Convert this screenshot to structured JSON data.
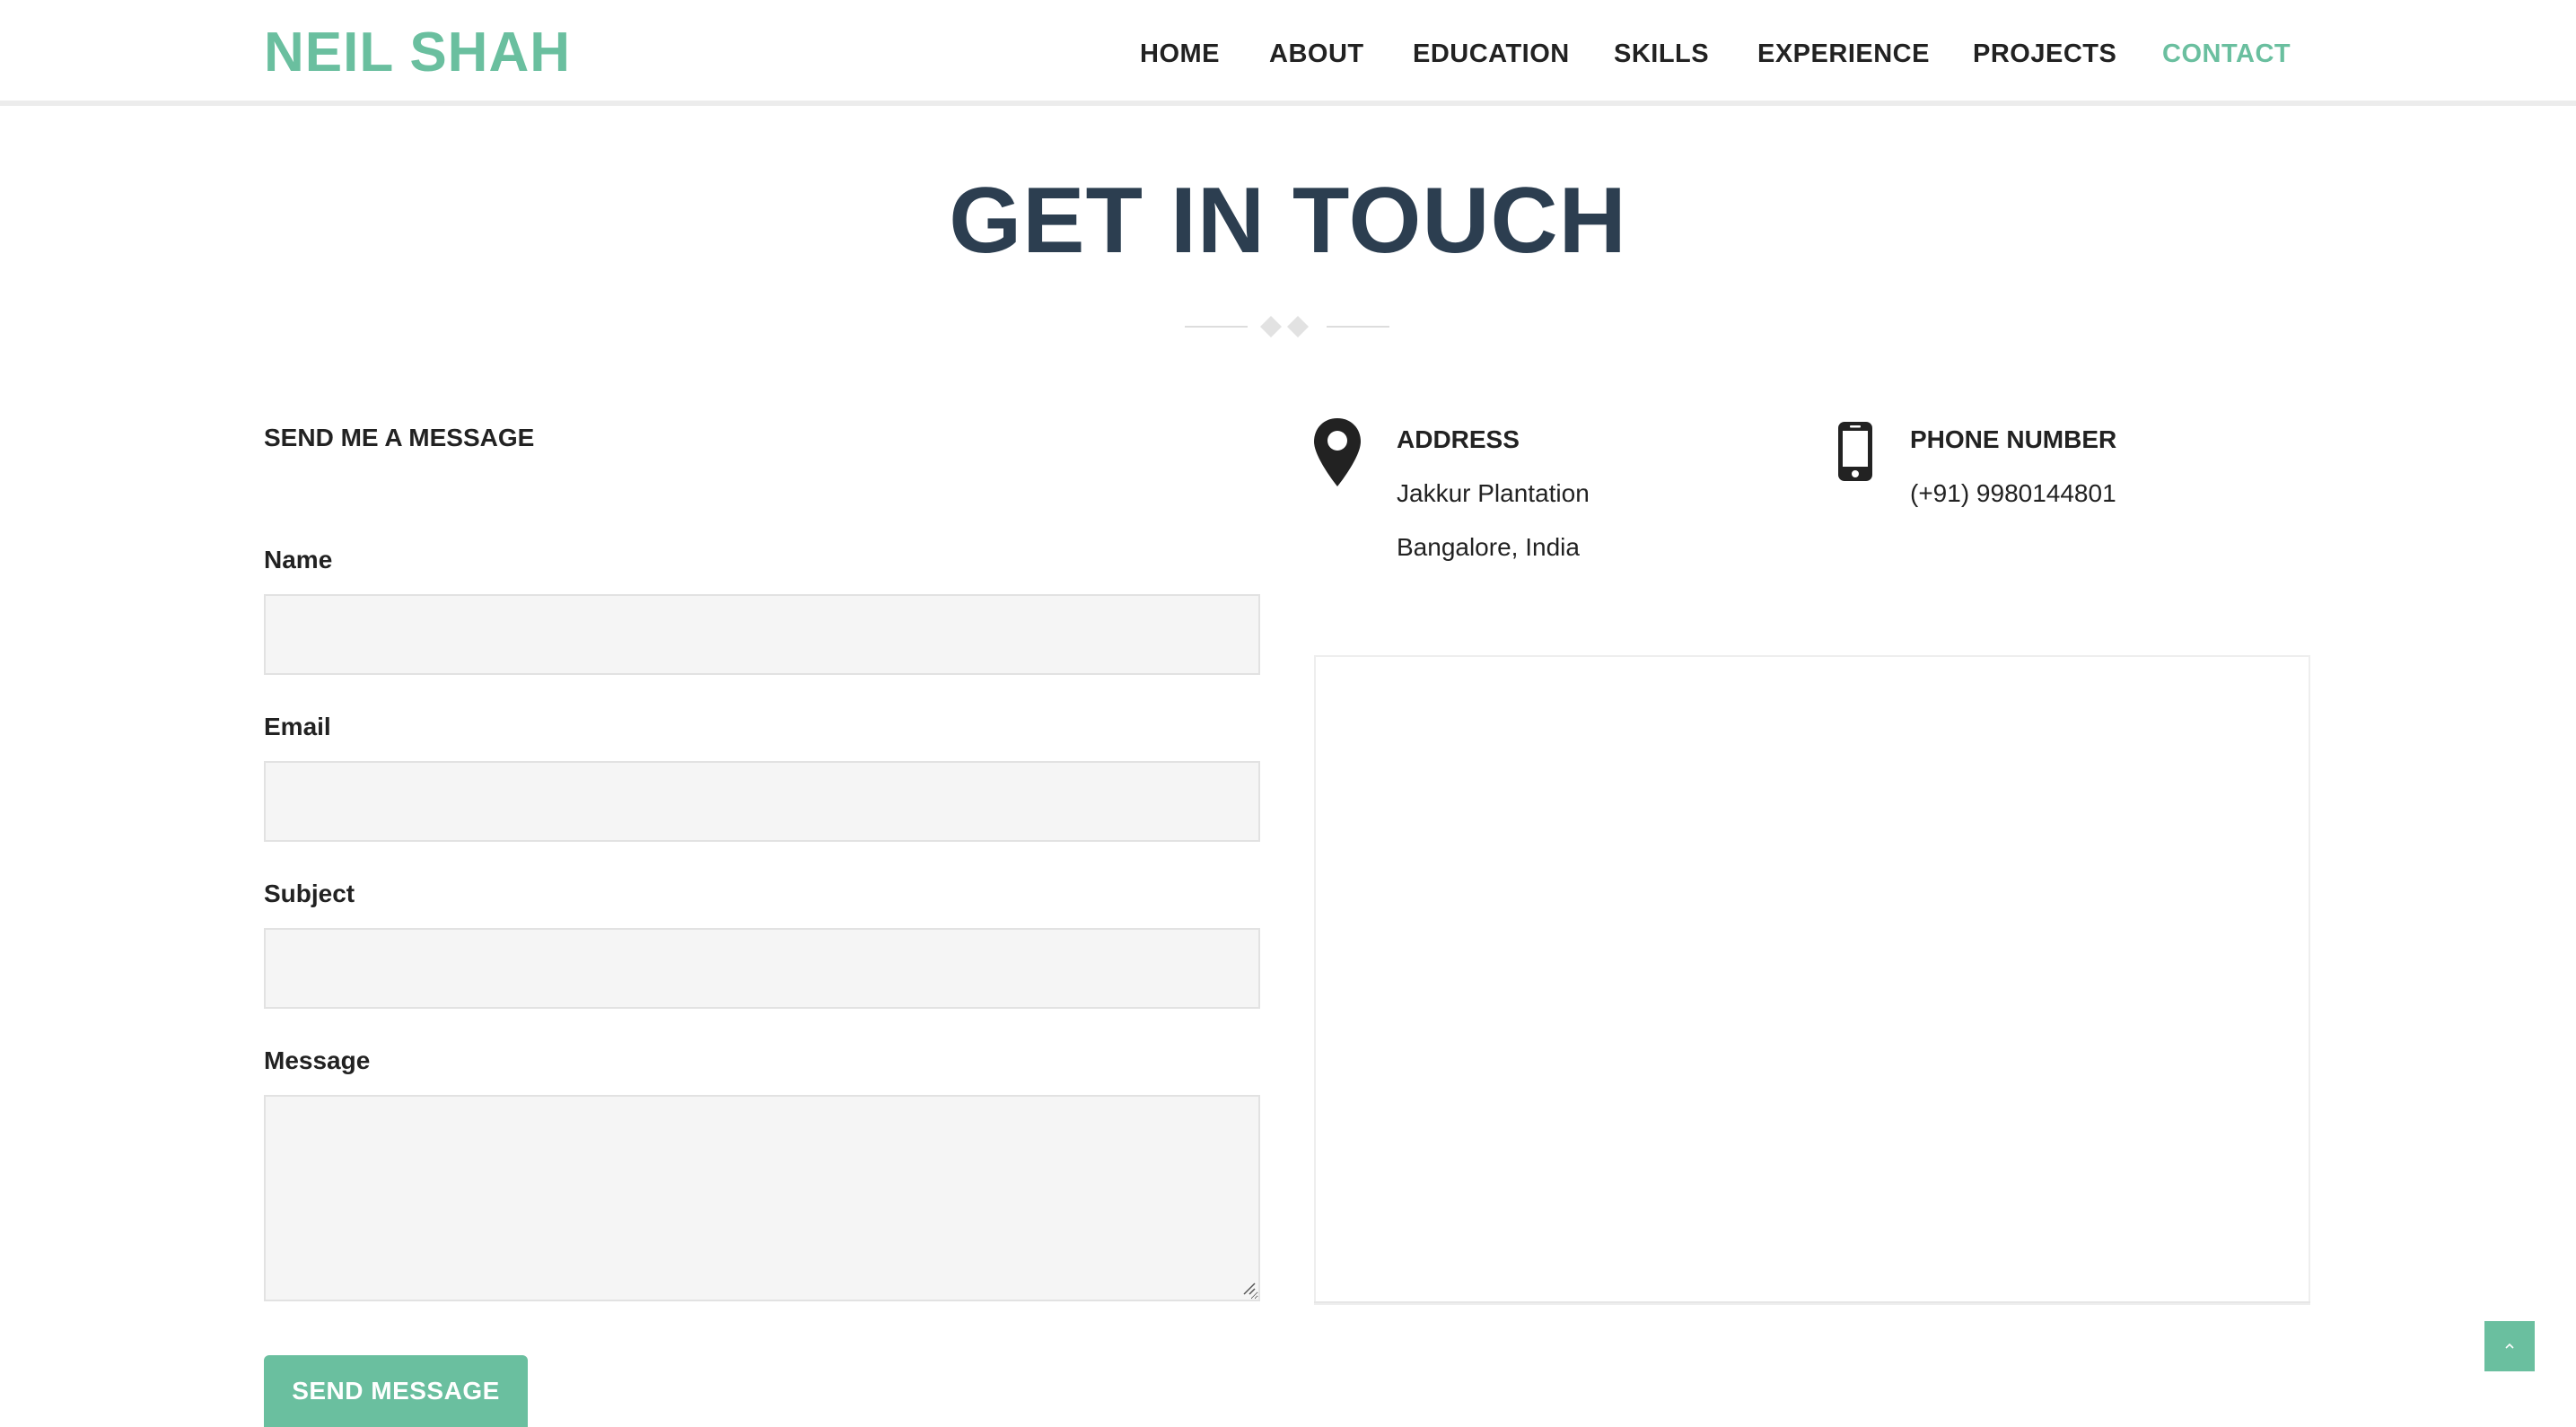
{
  "brand": {
    "name": "NEIL SHAH",
    "color": "#6abf9f"
  },
  "nav": {
    "items": [
      {
        "label": "HOME",
        "active": false
      },
      {
        "label": "ABOUT",
        "active": false
      },
      {
        "label": "EDUCATION",
        "active": false
      },
      {
        "label": "SKILLS",
        "active": false
      },
      {
        "label": "EXPERIENCE",
        "active": false
      },
      {
        "label": "PROJECTS",
        "active": false
      },
      {
        "label": "CONTACT",
        "active": true
      }
    ]
  },
  "page": {
    "title": "GET IN TOUCH"
  },
  "form": {
    "heading": "SEND ME A MESSAGE",
    "name_label": "Name",
    "name_value": "",
    "email_label": "Email",
    "email_value": "",
    "subject_label": "Subject",
    "subject_value": "",
    "message_label": "Message",
    "message_value": "",
    "submit_label": "SEND MESSAGE"
  },
  "contact": {
    "address": {
      "icon": "map-marker-icon",
      "title": "ADDRESS",
      "line1": "Jakkur Plantation",
      "line2": "Bangalore, India"
    },
    "phone": {
      "icon": "mobile-phone-icon",
      "title": "PHONE NUMBER",
      "number": "(+91) 9980144801"
    }
  },
  "colors": {
    "accent": "#6abf9f",
    "title": "#2c3e50",
    "text": "#222222",
    "input_bg": "#f5f5f5"
  },
  "back_to_top": {
    "icon": "chevron-up-icon"
  }
}
